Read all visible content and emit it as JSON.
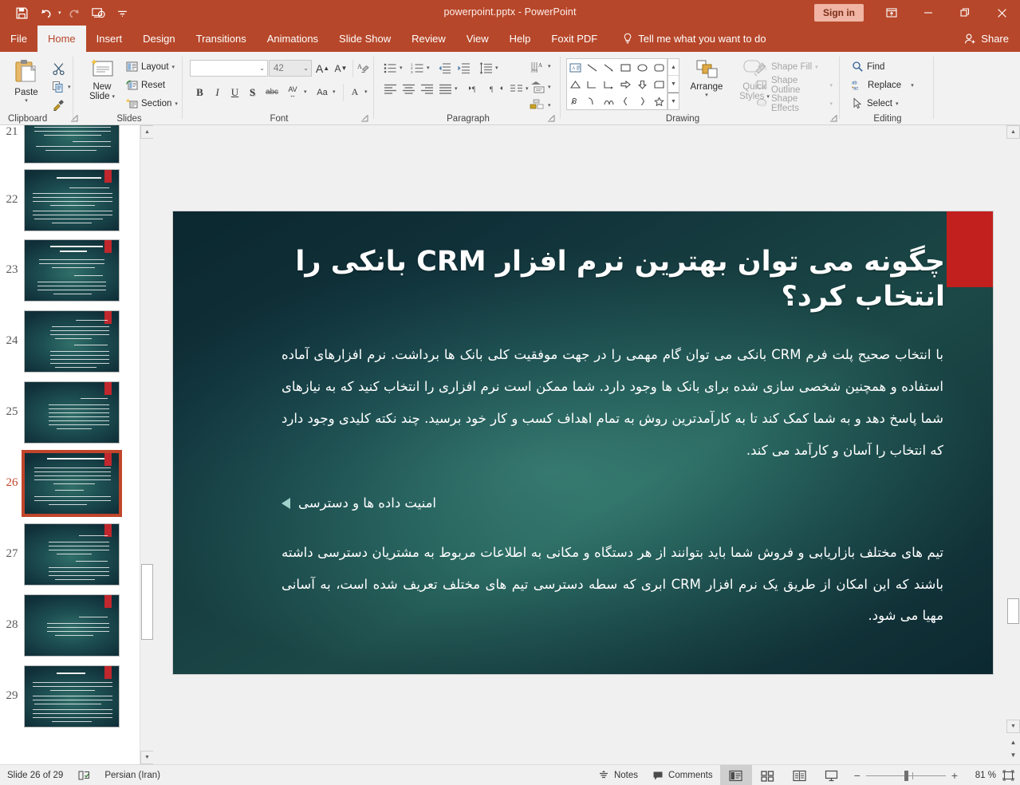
{
  "titlebar": {
    "document_title": "powerpoint.pptx  -  PowerPoint",
    "signin_label": "Sign in",
    "qat": [
      {
        "name": "save-icon",
        "label": "Save"
      },
      {
        "name": "undo-icon",
        "label": "Undo"
      },
      {
        "name": "redo-icon",
        "label": "Redo"
      },
      {
        "name": "start-from-beginning-icon",
        "label": "Start From Beginning"
      },
      {
        "name": "customize-quick-access-toolbar-icon",
        "label": "Customize Quick Access Toolbar"
      }
    ],
    "window_buttons": [
      {
        "name": "ribbon-display-options-icon",
        "label": "Ribbon Display Options"
      },
      {
        "name": "minimize-icon",
        "label": "Minimize"
      },
      {
        "name": "restore-icon",
        "label": "Restore Down"
      },
      {
        "name": "close-icon",
        "label": "Close"
      }
    ]
  },
  "tabs": [
    {
      "id": "file",
      "label": "File",
      "active": false
    },
    {
      "id": "home",
      "label": "Home",
      "active": true
    },
    {
      "id": "insert",
      "label": "Insert",
      "active": false
    },
    {
      "id": "design",
      "label": "Design",
      "active": false
    },
    {
      "id": "transitions",
      "label": "Transitions",
      "active": false
    },
    {
      "id": "animations",
      "label": "Animations",
      "active": false
    },
    {
      "id": "slideshow",
      "label": "Slide Show",
      "active": false
    },
    {
      "id": "review",
      "label": "Review",
      "active": false
    },
    {
      "id": "view",
      "label": "View",
      "active": false
    },
    {
      "id": "help",
      "label": "Help",
      "active": false
    },
    {
      "id": "foxitpdf",
      "label": "Foxit PDF",
      "active": false
    }
  ],
  "tellme": {
    "label": "Tell me what you want to do"
  },
  "share": {
    "label": "Share"
  },
  "ribbon": {
    "groups": [
      {
        "id": "clipboard",
        "label": "Clipboard"
      },
      {
        "id": "slides",
        "label": "Slides"
      },
      {
        "id": "font",
        "label": "Font"
      },
      {
        "id": "paragraph",
        "label": "Paragraph"
      },
      {
        "id": "drawing",
        "label": "Drawing"
      },
      {
        "id": "editing",
        "label": "Editing"
      }
    ],
    "clipboard": {
      "paste_label": "Paste",
      "cut_label": "Cut",
      "copy_label": "Copy",
      "format_painter_label": "Format Painter"
    },
    "slides": {
      "new_slide_line1": "New",
      "new_slide_line2": "Slide",
      "layout_label": "Layout",
      "reset_label": "Reset",
      "section_label": "Section"
    },
    "font": {
      "font_name_value": "",
      "font_name_placeholder": "",
      "font_size_value": "42",
      "increase_font_label": "A",
      "decrease_font_label": "A",
      "clear_formatting_label": "A",
      "bold_label": "B",
      "italic_label": "I",
      "underline_label": "U",
      "shadow_label": "S",
      "strikethrough_label": "abc",
      "char_spacing_label": "AV",
      "change_case_label": "Aa",
      "font_color_label": "A"
    },
    "drawing": {
      "arrange_label": "Arrange",
      "quick_styles_line1": "Quick",
      "quick_styles_line2": "Styles",
      "shape_fill_label": "Shape Fill",
      "shape_outline_label": "Shape Outline",
      "shape_effects_label": "Shape Effects"
    },
    "editing": {
      "find_label": "Find",
      "replace_label": "Replace",
      "select_label": "Select"
    }
  },
  "thumbnails": {
    "items": [
      {
        "number": "21",
        "selected": false,
        "has_title": true,
        "lines": 9
      },
      {
        "number": "22",
        "selected": false,
        "has_title": true,
        "lines": 10
      },
      {
        "number": "23",
        "selected": false,
        "has_title": true,
        "lines": 9
      },
      {
        "number": "24",
        "selected": false,
        "has_title": false,
        "lines": 11
      },
      {
        "number": "25",
        "selected": false,
        "has_title": false,
        "lines": 8
      },
      {
        "number": "26",
        "selected": true,
        "has_title": true,
        "lines": 9
      },
      {
        "number": "27",
        "selected": false,
        "has_title": false,
        "lines": 10
      },
      {
        "number": "28",
        "selected": false,
        "has_title": false,
        "lines": 5
      },
      {
        "number": "29",
        "selected": false,
        "has_title": true,
        "lines": 11
      }
    ]
  },
  "slide": {
    "title": "چگونه می توان بهترین نرم افزار CRM بانکی را انتخاب کرد؟",
    "paragraph_1": "با انتخاب صحیح پلت فرم CRM بانکی می توان گام مهمی را در جهت موفقیت کلی بانک ها برداشت. نرم افزارهای آماده استفاده و همچنین شخصی سازی شده برای بانک ها وجود دارد. شما ممکن است نرم افزاری را انتخاب کنید که به نیازهای شما پاسخ دهد و به شما کمک کند تا به کارآمدترین روش به تمام اهداف کسب و کار خود برسید. چند نکته کلیدی وجود دارد که انتخاب را آسان و کارآمد می کند.",
    "bullet_1": "امنیت داده ها و دسترسی",
    "paragraph_2": "تیم های مختلف بازاریابی و فروش شما باید بتوانند از هر دستگاه و مکانی به اطلاعات مربوط به مشتریان دسترسی داشته باشند که این امکان از طریق یک نرم افزار CRM ابری که سطه دسترسی تیم های مختلف تعریف شده است، به آسانی مهیا می شود.",
    "accent_color": "#c1201f",
    "background_color": "#1d4f52"
  },
  "statusbar": {
    "slide_counter": "Slide 26 of 29",
    "spellcheck_name": "spell-check-icon",
    "language": "Persian (Iran)",
    "notes_label": "Notes",
    "comments_label": "Comments",
    "views": [
      {
        "id": "normal",
        "label": "Normal",
        "active": true
      },
      {
        "id": "slide-sorter",
        "label": "Slide Sorter",
        "active": false
      },
      {
        "id": "reading-view",
        "label": "Reading View",
        "active": false
      },
      {
        "id": "slide-show",
        "label": "Slide Show",
        "active": false
      }
    ],
    "zoom_out_label": "−",
    "zoom_in_label": "+",
    "zoom_value": "81 %",
    "fit_label": "Fit slide to current window"
  }
}
